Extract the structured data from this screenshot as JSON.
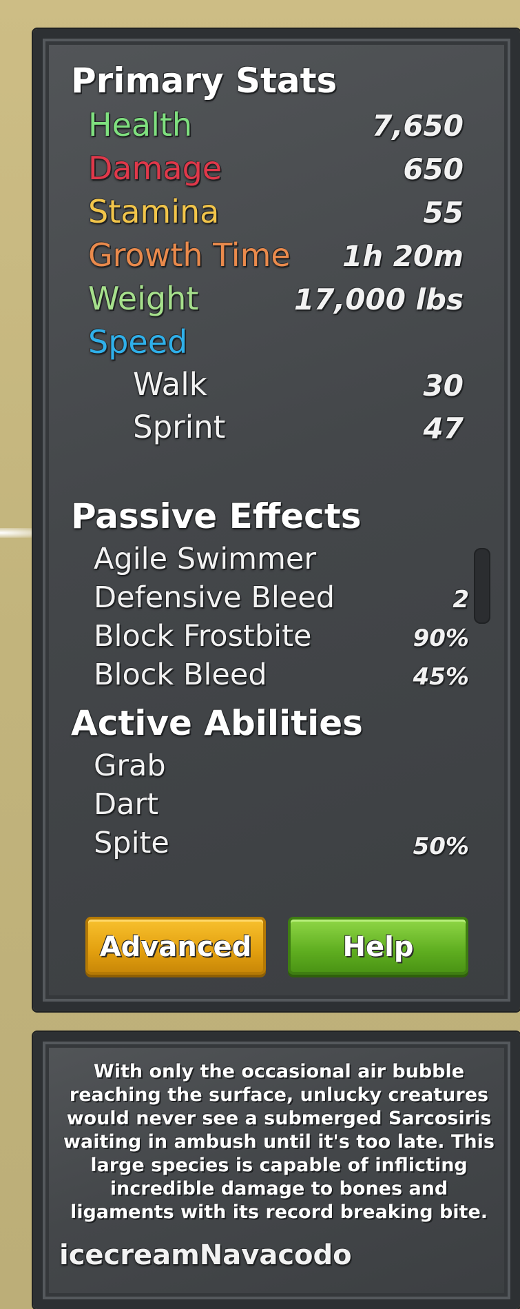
{
  "stats": {
    "primary_heading": "Primary Stats",
    "rows": [
      {
        "label": "Health",
        "value": "7,650",
        "color": "#7fe07f"
      },
      {
        "label": "Damage",
        "value": "650",
        "color": "#e0384a"
      },
      {
        "label": "Stamina",
        "value": "55",
        "color": "#f2c54a"
      },
      {
        "label": "Growth Time",
        "value": "1h 20m",
        "color": "#ea8a4c"
      },
      {
        "label": "Weight",
        "value": "17,000 lbs",
        "color": "#a6e08c"
      },
      {
        "label": "Speed",
        "value": "",
        "color": "#2fb0ea"
      }
    ],
    "speed": [
      {
        "label": "Walk",
        "value": "30"
      },
      {
        "label": "Sprint",
        "value": "47"
      }
    ]
  },
  "passive": {
    "heading": "Passive Effects",
    "items": [
      {
        "label": "Agile Swimmer",
        "value": ""
      },
      {
        "label": "Defensive Bleed",
        "value": "2"
      },
      {
        "label": "Block Frostbite",
        "value": "90%"
      },
      {
        "label": "Block Bleed",
        "value": "45%"
      }
    ]
  },
  "active": {
    "heading": "Active Abilities",
    "items": [
      {
        "label": "Grab",
        "value": ""
      },
      {
        "label": "Dart",
        "value": ""
      },
      {
        "label": "Spite",
        "value": "50%"
      }
    ]
  },
  "buttons": {
    "advanced": "Advanced",
    "help": "Help"
  },
  "lore": {
    "text": "With only the occasional air bubble reaching the surface, unlucky creatures would never see a submerged Sarcosiris waiting in ambush until it's too late. This large species is capable of inflicting incredible damage to bones and ligaments with its record breaking bite.",
    "author": "icecreamNavacodo"
  }
}
